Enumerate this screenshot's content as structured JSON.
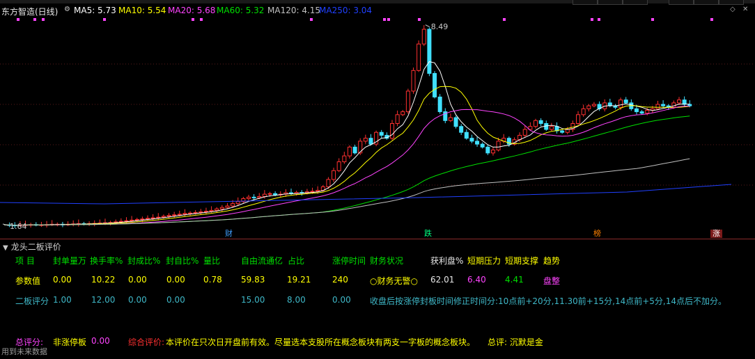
{
  "legend": {
    "title": "东方智造(日线)",
    "ma5": "MA5: 5.73",
    "ma10": "MA10: 5.54",
    "ma20": "MA20: 5.68",
    "ma60": "MA60: 5.32",
    "ma120": "MA120: 4.15",
    "ma250": "MA250: 3.04"
  },
  "colors": {
    "up": "#ff3030",
    "down": "#40e0ff",
    "ma5": "#ffffff",
    "ma10": "#ffff00",
    "ma20": "#ff44ff",
    "ma60": "#00e000",
    "ma120": "#c0c0c0",
    "ma250": "#2040ff"
  },
  "price_labels": {
    "high": "8.49",
    "low": "1.64"
  },
  "event_tags": [
    {
      "text": "财",
      "color": "#3f9fff"
    },
    {
      "text": "跌",
      "color": "#00ff80"
    },
    {
      "text": "榜",
      "color": "#ff8000"
    },
    {
      "text": "涨",
      "color": "#ffffff"
    }
  ],
  "panel": {
    "title": "龙头二板评价",
    "headers": [
      "项  目",
      "封单量万",
      "换手率%",
      "封成比%",
      "封自比%",
      "量比",
      "自由流通亿",
      "占比",
      "涨停时间",
      "财务状况",
      "获利盘%",
      "短期压力",
      "短期支撑",
      "趋势"
    ],
    "param_row": {
      "label": "参数值",
      "values": [
        "0.00",
        "10.22",
        "0.00",
        "0.00",
        "0.78",
        "59.83",
        "19.21",
        "240",
        "○财务无警○",
        "62.01",
        "6.40",
        "4.41",
        "盘整"
      ]
    },
    "score_row": {
      "label": "二板评分",
      "values": [
        "1.00",
        "12.00",
        "0.00",
        "0.00",
        "15.00",
        "8.00",
        "0.00"
      ],
      "note": "收盘后按涨停封板时间修正时间分:10点前+20分,11.30前+15分,14点前+5分,14点后不加分。"
    },
    "total": {
      "label": "总评分:",
      "status": "非涨停板",
      "score": "0.00",
      "comprehensive_label": "综合评价:",
      "comprehensive_text": "本评价在只次日开盘前有效。尽量选本支股所在概念板块有两支一字板的概念板块。",
      "verdict": "总评:  沉默是金"
    }
  },
  "footer": "用到未来数据"
}
